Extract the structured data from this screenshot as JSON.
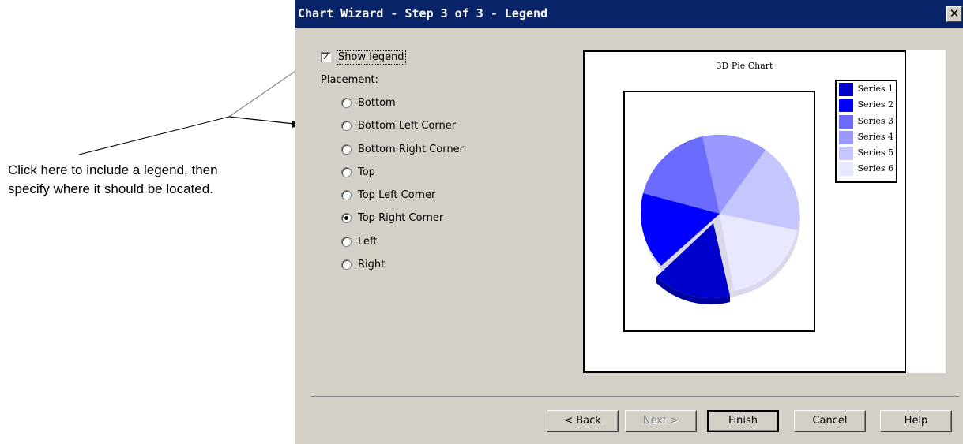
{
  "callout": {
    "line1": "Click here to include a legend, then",
    "line2": "specify where it should be located."
  },
  "dialog": {
    "title": "Chart Wizard - Step 3 of 3 - Legend",
    "close_glyph": "✕"
  },
  "legend_options": {
    "show_legend_label": "Show legend",
    "show_legend_checked": true,
    "check_glyph": "✓",
    "placement_label": "Placement:",
    "placements": [
      {
        "label": "Bottom",
        "checked": false
      },
      {
        "label": "Bottom Left Corner",
        "checked": false
      },
      {
        "label": "Bottom Right Corner",
        "checked": false
      },
      {
        "label": "Top",
        "checked": false
      },
      {
        "label": "Top Left Corner",
        "checked": false
      },
      {
        "label": "Top Right Corner",
        "checked": true
      },
      {
        "label": "Left",
        "checked": false
      },
      {
        "label": "Right",
        "checked": false
      }
    ]
  },
  "preview": {
    "chart_title": "3D Pie Chart",
    "legend": [
      {
        "label": "Series 1",
        "color": "#0000cc"
      },
      {
        "label": "Series 2",
        "color": "#0000ff"
      },
      {
        "label": "Series 3",
        "color": "#6b6bff"
      },
      {
        "label": "Series 4",
        "color": "#9999ff"
      },
      {
        "label": "Series 5",
        "color": "#c6c6ff"
      },
      {
        "label": "Series 6",
        "color": "#e8e8ff"
      }
    ]
  },
  "buttons": {
    "back": "< Back",
    "next": "Next >",
    "finish": "Finish",
    "cancel": "Cancel",
    "help": "Help"
  },
  "colors": {
    "titlebar": "#0a246a",
    "dialog_bg": "#d4d0c8"
  }
}
